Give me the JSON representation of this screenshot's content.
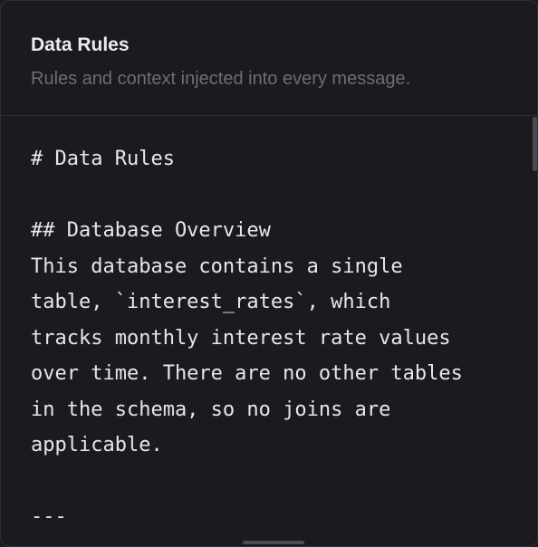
{
  "header": {
    "title": "Data Rules",
    "subtitle": "Rules and context injected into every message."
  },
  "editor": {
    "content": "# Data Rules\n\n## Database Overview\nThis database contains a single\ntable, `interest_rates`, which\ntracks monthly interest rate values\nover time. There are no other tables\nin the schema, so no joins are\napplicable.\n\n---"
  },
  "colors": {
    "background": "#1b1b1f",
    "border": "#2e2f35",
    "title": "#ecedf0",
    "subtitle": "#6b6e78",
    "text": "#e6e7ea"
  }
}
